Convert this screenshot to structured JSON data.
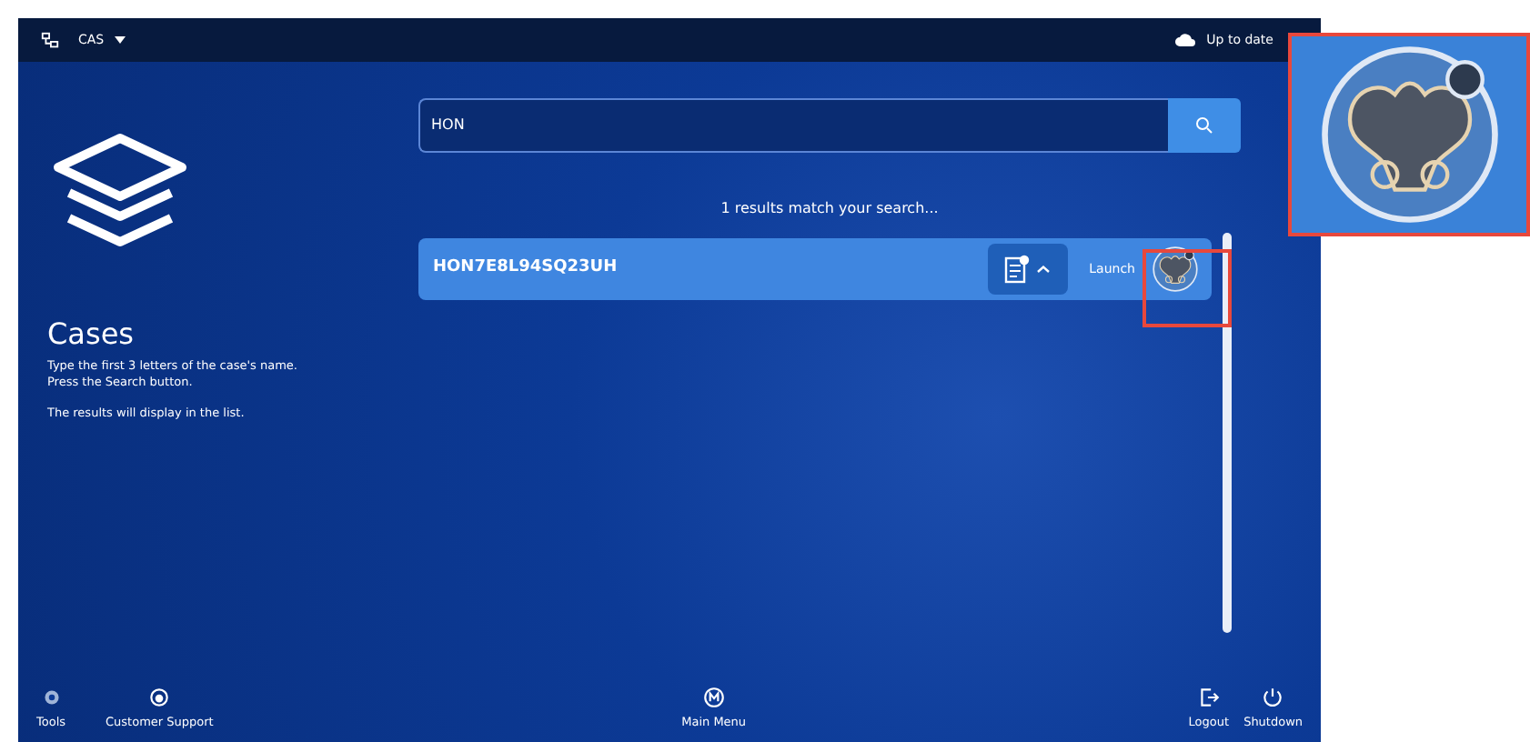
{
  "top_bar": {
    "user": "CAS",
    "sync_status": "Up to date"
  },
  "sidebar": {
    "title": "Cases",
    "instructions": [
      "Type the first 3 letters of the case's name. Press the Search button.",
      "The results will display in the list."
    ]
  },
  "search": {
    "value": "HON"
  },
  "results_summary": "1 results match your search...",
  "results": [
    {
      "name": "HON7E8L94SQ23UH",
      "action": "Launch"
    }
  ],
  "bottom_bar": {
    "left": [
      {
        "label": "Tools",
        "kind": "gear"
      },
      {
        "label": "Customer Support",
        "kind": "support"
      }
    ],
    "center": [
      {
        "label": "Main Menu",
        "kind": "menu"
      }
    ],
    "right": [
      {
        "label": "Logout",
        "kind": "logout"
      },
      {
        "label": "Shutdown",
        "kind": "power"
      }
    ]
  }
}
